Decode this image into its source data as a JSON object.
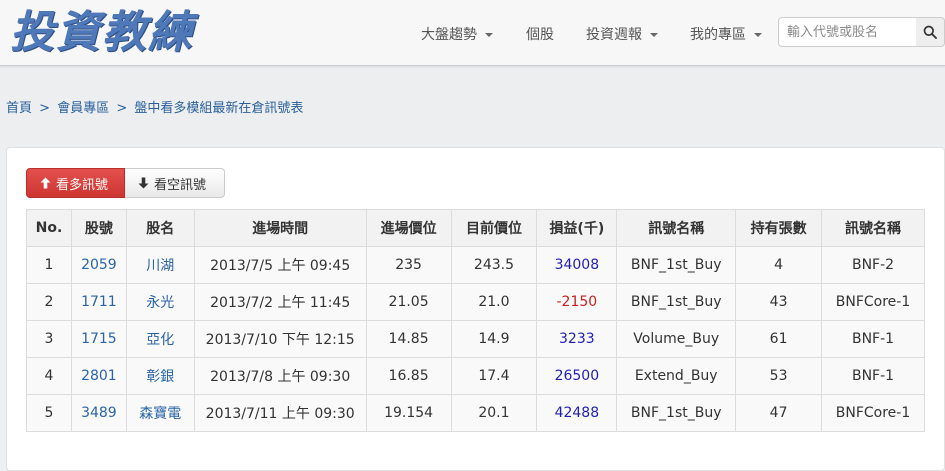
{
  "header": {
    "logo_text": "投資教練",
    "nav": [
      {
        "label": "大盤趨勢",
        "has_caret": true
      },
      {
        "label": "個股",
        "has_caret": false
      },
      {
        "label": "投資週報",
        "has_caret": true
      },
      {
        "label": "我的專區",
        "has_caret": true
      }
    ],
    "search": {
      "placeholder": "輸入代號或股名",
      "value": ""
    }
  },
  "breadcrumb": [
    "首頁",
    "會員專區",
    "盤中看多模組最新在倉訊號表"
  ],
  "breadcrumb_separator": ">",
  "buttons": {
    "long_signal": "看多訊號",
    "short_signal": "看空訊號"
  },
  "table": {
    "headers": [
      "No.",
      "股號",
      "股名",
      "進場時間",
      "進場價位",
      "目前價位",
      "損益(千)",
      "訊號名稱",
      "持有張數",
      "訊號名稱"
    ],
    "rows": [
      {
        "no": "1",
        "code": "2059",
        "name": "川湖",
        "entry_time": "2013/7/5 上午 09:45",
        "entry_price": "235",
        "current_price": "243.5",
        "pnl": "34008",
        "signal": "BNF_1st_Buy",
        "shares": "4",
        "signal2": "BNF-2"
      },
      {
        "no": "2",
        "code": "1711",
        "name": "永光",
        "entry_time": "2013/7/2 上午 11:45",
        "entry_price": "21.05",
        "current_price": "21.0",
        "pnl": "-2150",
        "signal": "BNF_1st_Buy",
        "shares": "43",
        "signal2": "BNFCore-1"
      },
      {
        "no": "3",
        "code": "1715",
        "name": "亞化",
        "entry_time": "2013/7/10 下午 12:15",
        "entry_price": "14.85",
        "current_price": "14.9",
        "pnl": "3233",
        "signal": "Volume_Buy",
        "shares": "61",
        "signal2": "BNF-1"
      },
      {
        "no": "4",
        "code": "2801",
        "name": "彰銀",
        "entry_time": "2013/7/8 上午 09:30",
        "entry_price": "16.85",
        "current_price": "17.4",
        "pnl": "26500",
        "signal": "Extend_Buy",
        "shares": "53",
        "signal2": "BNF-1"
      },
      {
        "no": "5",
        "code": "3489",
        "name": "森寶電",
        "entry_time": "2013/7/11 上午 09:30",
        "entry_price": "19.154",
        "current_price": "20.1",
        "pnl": "42488",
        "signal": "BNF_1st_Buy",
        "shares": "47",
        "signal2": "BNFCore-1"
      }
    ]
  },
  "colors": {
    "positive_pnl": "#1f1fb4",
    "negative_pnl": "#c62020",
    "link": "#2a64a8",
    "long_button": "#d9403d"
  }
}
